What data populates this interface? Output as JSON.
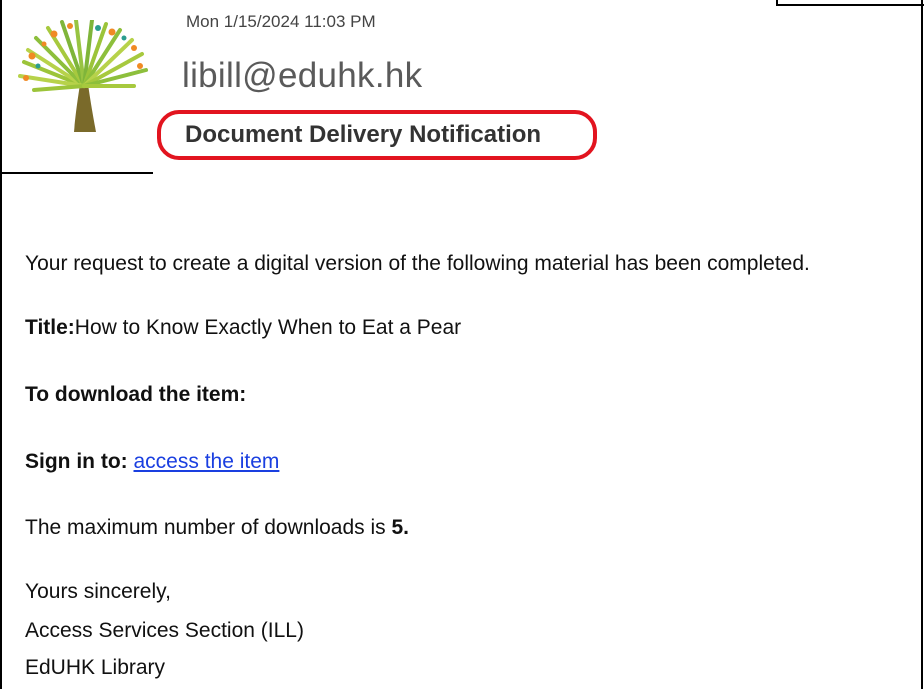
{
  "email": {
    "date": "Mon 1/15/2024 11:03 PM",
    "sender": "libill@eduhk.hk",
    "subject": "Document Delivery Notification"
  },
  "message": {
    "intro": "Your request to create a digital version of the following material has been completed.",
    "title_label": "Title:",
    "title_value": "How to Know Exactly When to Eat a Pear",
    "download_heading": "To download the item:",
    "signin_label": "Sign in to:",
    "signin_link": "access the item",
    "max_downloads_text": "The maximum number of downloads is ",
    "max_downloads_value": "5.",
    "closing": "Yours sincerely,",
    "signature_line1": "Access Services Section (ILL)",
    "signature_line2": "EdUHK Library"
  },
  "colors": {
    "highlight_ring": "#e2141f",
    "link": "#1a3fe0"
  },
  "icons": {
    "logo": "tree-logo"
  }
}
